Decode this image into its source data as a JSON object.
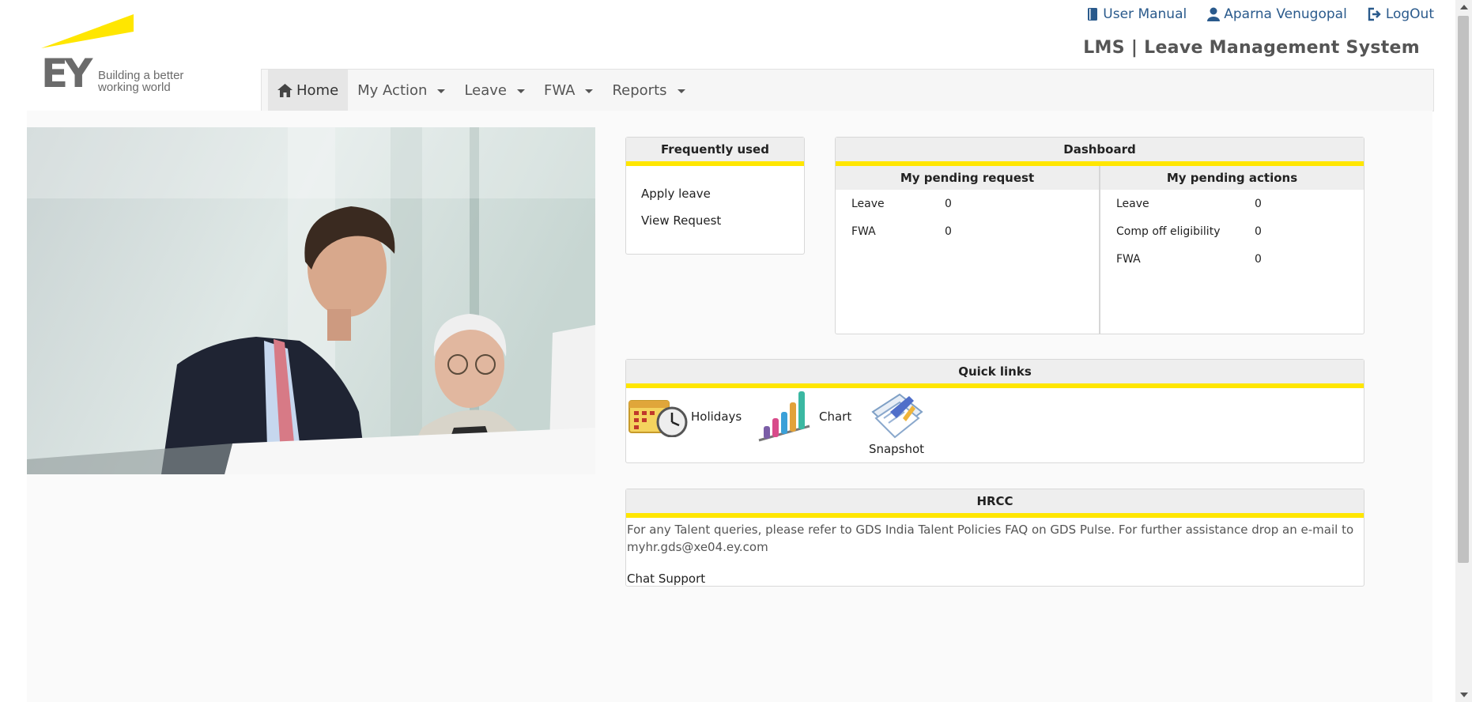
{
  "brand": {
    "logo_text": "EY",
    "tagline_line1": "Building a better",
    "tagline_line2": "working world",
    "accent_color": "#ffe600"
  },
  "header": {
    "user_manual": "User Manual",
    "user_name": "Aparna Venugopal",
    "logout": "LogOut",
    "app_title": "LMS | Leave Management System"
  },
  "nav": {
    "home": "Home",
    "my_action": "My Action",
    "leave": "Leave",
    "fwa": "FWA",
    "reports": "Reports"
  },
  "frequently_used": {
    "title": "Frequently used",
    "links": [
      "Apply leave",
      "View Request"
    ]
  },
  "dashboard": {
    "title": "Dashboard",
    "pending_request": {
      "title": "My pending request",
      "rows": [
        {
          "label": "Leave",
          "count": "0"
        },
        {
          "label": "FWA",
          "count": "0"
        }
      ]
    },
    "pending_actions": {
      "title": "My pending actions",
      "rows": [
        {
          "label": "Leave",
          "count": "0"
        },
        {
          "label": "Comp off eligibility",
          "count": "0"
        },
        {
          "label": "FWA",
          "count": "0"
        }
      ]
    }
  },
  "quick_links": {
    "title": "Quick links",
    "items": [
      "Holidays",
      "Chart",
      "Snapshot"
    ]
  },
  "hrcc": {
    "title": "HRCC",
    "text": "For any Talent queries, please refer to GDS India Talent Policies FAQ on GDS Pulse. For further assistance drop an e-mail to myhr.gds@xe04.ey.com",
    "chat_support": "Chat Support"
  }
}
